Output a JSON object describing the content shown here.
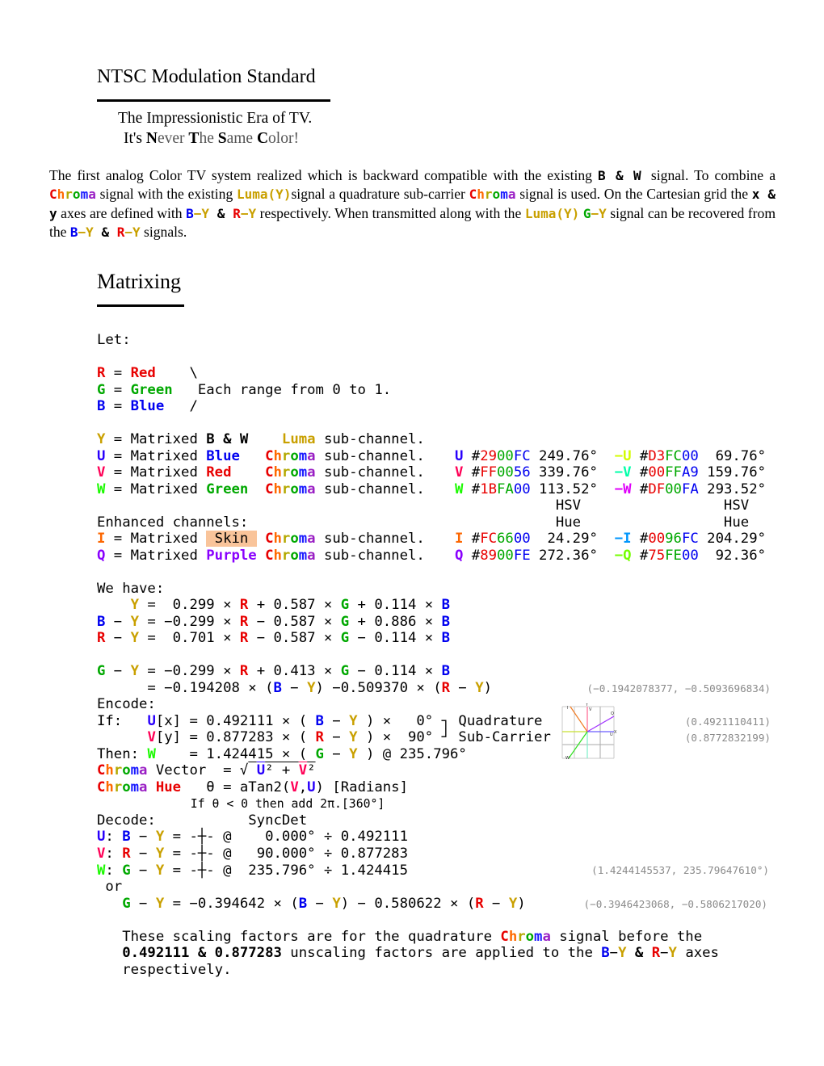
{
  "header": {
    "title": "NTSC Modulation Standard",
    "subtitle_line1": "The Impressionistic Era of TV.",
    "subtitle_line2": [
      [
        "It's ",
        ""
      ],
      [
        "N",
        "b"
      ],
      [
        "ever ",
        "g"
      ],
      [
        "T",
        "b"
      ],
      [
        "he ",
        "g"
      ],
      [
        "S",
        "b"
      ],
      [
        "ame ",
        "g"
      ],
      [
        "C",
        "b"
      ],
      [
        "olor!",
        "g"
      ]
    ]
  },
  "colors": {
    "Y": "#c9a000",
    "R": "#e80000",
    "G": "#00a800",
    "B": "#0000f0",
    "U": "#2900FC",
    "V": "#FF0056",
    "W": "#1BFA00",
    "I": "#FC6600",
    "Q": "#8900FE",
    "nU": "#D3FC00",
    "nV": "#00FFA9",
    "nW": "#DF00FA",
    "nI": "#0096FC",
    "nQ": "#75FE00",
    "K": "#000000",
    "chroma": [
      "#e80000",
      "#ff6a00",
      "#b3a800",
      "#00a800",
      "#1a1aff",
      "#9a1fc4"
    ]
  },
  "intro": [
    [
      "The first analog Color TV system realized which is backward compatible with the existing ",
      "",
      ""
    ],
    [
      " B & W ",
      "",
      "m"
    ],
    [
      " signal. To combine a ",
      "",
      ""
    ],
    [
      "Chroma",
      "CH",
      "m"
    ],
    [
      " signal with the existing ",
      "",
      ""
    ],
    [
      "Luma(Y)",
      "Y",
      "m"
    ],
    [
      "signal a quadrature sub-carrier ",
      "",
      ""
    ],
    [
      "Chroma",
      "CH",
      "m"
    ],
    [
      " signal is used. On the Cartesian grid the ",
      "",
      ""
    ],
    [
      "x & y",
      "",
      "m"
    ],
    [
      " axes are defined with ",
      "",
      ""
    ],
    [
      "B",
      "B",
      "m"
    ],
    [
      "−Y",
      "Y",
      "m"
    ],
    [
      " & ",
      "",
      "m"
    ],
    [
      "R",
      "R",
      "m"
    ],
    [
      "−Y",
      "Y",
      "m"
    ],
    [
      " respectively. When transmitted along with the ",
      "",
      ""
    ],
    [
      "Luma(Y)",
      "Y",
      "m"
    ],
    [
      " ",
      "",
      ""
    ],
    [
      "G",
      "G",
      "m"
    ],
    [
      "−Y",
      "Y",
      "m"
    ],
    [
      " signal can be recovered from the ",
      "",
      ""
    ],
    [
      "B",
      "B",
      "m"
    ],
    [
      "−Y",
      "Y",
      "m"
    ],
    [
      " & ",
      "",
      "m"
    ],
    [
      "R",
      "R",
      "m"
    ],
    [
      "−Y",
      "Y",
      "m"
    ],
    [
      " signals.",
      "",
      ""
    ]
  ],
  "section_title": "Matrixing",
  "lines": [
    [
      [
        "Let:",
        "",
        ""
      ]
    ],
    [],
    [
      [
        "R",
        "R",
        "b"
      ],
      [
        " = ",
        "",
        ""
      ],
      [
        "Red",
        "R",
        "b"
      ],
      [
        "    \\",
        "",
        ""
      ]
    ],
    [
      [
        "G",
        "G",
        "b"
      ],
      [
        " = ",
        "",
        ""
      ],
      [
        "Green",
        "G",
        "b"
      ],
      [
        "   Each range from 0 to 1.",
        "",
        ""
      ]
    ],
    [
      [
        "B",
        "B",
        "b"
      ],
      [
        " = ",
        "",
        ""
      ],
      [
        "Blue",
        "B",
        "b"
      ],
      [
        "   /",
        "",
        ""
      ]
    ],
    [],
    [
      [
        "Y",
        "Y",
        "b"
      ],
      [
        " = Matrixed ",
        "",
        ""
      ],
      [
        "B & W",
        "K",
        "b"
      ],
      [
        "    ",
        "",
        ""
      ],
      [
        "Luma",
        "Y",
        "b"
      ],
      [
        " sub-channel.",
        "",
        ""
      ]
    ],
    [
      [
        "U",
        "U",
        "b"
      ],
      [
        " = Matrixed ",
        "",
        ""
      ],
      [
        "Blue",
        "B",
        "b"
      ],
      [
        "   ",
        "",
        ""
      ],
      [
        "Chroma",
        "CH",
        "b"
      ],
      [
        " sub-channel.",
        "",
        ""
      ]
    ],
    [
      [
        "V",
        "V",
        "b"
      ],
      [
        " = Matrixed ",
        "",
        ""
      ],
      [
        "Red",
        "R",
        "b"
      ],
      [
        "    ",
        "",
        ""
      ],
      [
        "Chroma",
        "CH",
        "b"
      ],
      [
        " sub-channel.",
        "",
        ""
      ]
    ],
    [
      [
        "W",
        "W",
        "b"
      ],
      [
        " = Matrixed ",
        "",
        ""
      ],
      [
        "Green",
        "G",
        "b"
      ],
      [
        "  ",
        "",
        ""
      ],
      [
        "Chroma",
        "CH",
        "b"
      ],
      [
        " sub-channel.",
        "",
        ""
      ]
    ],
    [],
    [
      [
        "Enhanced channels:",
        "",
        ""
      ]
    ],
    [
      [
        "I",
        "I",
        "b"
      ],
      [
        " = Matrixed ",
        "",
        ""
      ],
      [
        " Skin ",
        "",
        "s"
      ],
      [
        " ",
        "",
        ""
      ],
      [
        "Chroma",
        "CH",
        "b"
      ],
      [
        " sub-channel.",
        "",
        ""
      ]
    ],
    [
      [
        "Q",
        "Q",
        "b"
      ],
      [
        " = Matrixed ",
        "",
        ""
      ],
      [
        "Purple",
        "Q",
        "b"
      ],
      [
        " ",
        "",
        ""
      ],
      [
        "Chroma",
        "CH",
        "b"
      ],
      [
        " sub-channel.",
        "",
        ""
      ]
    ],
    [],
    [
      [
        "We have:",
        "",
        ""
      ]
    ],
    [
      [
        "    ",
        "",
        ""
      ],
      [
        "Y",
        "Y",
        "b"
      ],
      [
        " =  0.299 × ",
        "",
        ""
      ],
      [
        "R",
        "R",
        "b"
      ],
      [
        " + 0.587 × ",
        "",
        ""
      ],
      [
        "G",
        "G",
        "b"
      ],
      [
        " + 0.114 × ",
        "",
        ""
      ],
      [
        "B",
        "B",
        "b"
      ]
    ],
    [
      [
        "B",
        "B",
        "b"
      ],
      [
        " − ",
        "",
        ""
      ],
      [
        "Y",
        "Y",
        "b"
      ],
      [
        " = −0.299 × ",
        "",
        ""
      ],
      [
        "R",
        "R",
        "b"
      ],
      [
        " − 0.587 × ",
        "",
        ""
      ],
      [
        "G",
        "G",
        "b"
      ],
      [
        " + 0.886 × ",
        "",
        ""
      ],
      [
        "B",
        "B",
        "b"
      ]
    ],
    [
      [
        "R",
        "R",
        "b"
      ],
      [
        " − ",
        "",
        ""
      ],
      [
        "Y",
        "Y",
        "b"
      ],
      [
        " =  0.701 × ",
        "",
        ""
      ],
      [
        "R",
        "R",
        "b"
      ],
      [
        " − 0.587 × ",
        "",
        ""
      ],
      [
        "G",
        "G",
        "b"
      ],
      [
        " − 0.114 × ",
        "",
        ""
      ],
      [
        "B",
        "B",
        "b"
      ]
    ],
    [],
    [
      [
        "G",
        "G",
        "b"
      ],
      [
        " − ",
        "",
        ""
      ],
      [
        "Y",
        "Y",
        "b"
      ],
      [
        " = −0.299 × ",
        "",
        ""
      ],
      [
        "R",
        "R",
        "b"
      ],
      [
        " + 0.413 × ",
        "",
        ""
      ],
      [
        "G",
        "G",
        "b"
      ],
      [
        " − 0.114 × ",
        "",
        ""
      ],
      [
        "B",
        "B",
        "b"
      ]
    ],
    [
      [
        "      = −0.194208 × (",
        "",
        ""
      ],
      [
        "B",
        "B",
        "b"
      ],
      [
        " − ",
        "",
        ""
      ],
      [
        "Y",
        "Y",
        "b"
      ],
      [
        ") −0.509370 × (",
        "",
        ""
      ],
      [
        "R",
        "R",
        "b"
      ],
      [
        " − ",
        "",
        ""
      ],
      [
        "Y",
        "Y",
        "b"
      ],
      [
        ")",
        "",
        ""
      ]
    ],
    [
      [
        "Encode:",
        "",
        ""
      ]
    ],
    [
      [
        "If:   ",
        "",
        ""
      ],
      [
        "U",
        "U",
        "b"
      ],
      [
        "[x] = 0.492111 × ( ",
        "",
        ""
      ],
      [
        "B",
        "B",
        "b"
      ],
      [
        " − ",
        "",
        ""
      ],
      [
        "Y",
        "Y",
        "b"
      ],
      [
        " ) ×   0° ┐ Quadrature",
        "",
        ""
      ]
    ],
    [
      [
        "      ",
        "",
        ""
      ],
      [
        "V",
        "V",
        "b"
      ],
      [
        "[y] = 0.877283 × ( ",
        "",
        ""
      ],
      [
        "R",
        "R",
        "b"
      ],
      [
        " − ",
        "",
        ""
      ],
      [
        "Y",
        "Y",
        "b"
      ],
      [
        " ) ×  90° ┘ Sub-Carrier",
        "",
        ""
      ]
    ],
    [
      [
        "Then: ",
        "",
        ""
      ],
      [
        "W",
        "W",
        "b"
      ],
      [
        "    = 1.424415 × ( ",
        "",
        ""
      ],
      [
        "G",
        "G",
        "b"
      ],
      [
        " − ",
        "",
        ""
      ],
      [
        "Y",
        "Y",
        "b"
      ],
      [
        " ) @ 235.796°",
        "",
        ""
      ]
    ],
    [
      [
        "Chroma",
        "CH",
        "b"
      ],
      [
        " Vector  = √",
        "",
        ""
      ],
      [
        " ",
        "",
        "o"
      ],
      [
        "U",
        "U",
        "bo"
      ],
      [
        "² + ",
        "",
        "o"
      ],
      [
        "V",
        "V",
        "bo"
      ],
      [
        "²",
        "",
        "o"
      ]
    ],
    [
      [
        "Chroma",
        "CH",
        "b"
      ],
      [
        " ",
        "",
        ""
      ],
      [
        "Hue",
        "R",
        "b"
      ],
      [
        "   θ = aTan2(",
        "",
        ""
      ],
      [
        "V",
        "V",
        "b"
      ],
      [
        ",",
        "",
        ""
      ],
      [
        "U",
        "U",
        "b"
      ],
      [
        ") [Radians]",
        "",
        ""
      ]
    ],
    [
      [
        "             If θ < 0 then add 2π.[360°]",
        "",
        "small"
      ]
    ],
    [
      [
        "Decode:           SyncDet",
        "",
        ""
      ]
    ],
    [
      [
        "U",
        "U",
        "b"
      ],
      [
        ": ",
        "",
        ""
      ],
      [
        "B",
        "B",
        "b"
      ],
      [
        " − ",
        "",
        ""
      ],
      [
        "Y",
        "Y",
        "b"
      ],
      [
        " = -┼- @    0.000° ÷ 0.492111",
        "",
        ""
      ]
    ],
    [
      [
        "V",
        "V",
        "b"
      ],
      [
        ": ",
        "",
        ""
      ],
      [
        "R",
        "R",
        "b"
      ],
      [
        " − ",
        "",
        ""
      ],
      [
        "Y",
        "Y",
        "b"
      ],
      [
        " = -┼- @   90.000° ÷ 0.877283",
        "",
        ""
      ]
    ],
    [
      [
        "W",
        "W",
        "b"
      ],
      [
        ": ",
        "",
        ""
      ],
      [
        "G",
        "G",
        "b"
      ],
      [
        " − ",
        "",
        ""
      ],
      [
        "Y",
        "Y",
        "b"
      ],
      [
        " = -┼- @  235.796° ÷ 1.424415",
        "",
        ""
      ]
    ],
    [
      [
        " or",
        "",
        ""
      ]
    ],
    [
      [
        "   ",
        "",
        ""
      ],
      [
        "G",
        "G",
        "b"
      ],
      [
        " − ",
        "",
        ""
      ],
      [
        "Y",
        "Y",
        "b"
      ],
      [
        " = −0.394642 × (",
        "",
        ""
      ],
      [
        "B",
        "B",
        "b"
      ],
      [
        " − ",
        "",
        ""
      ],
      [
        "Y",
        "Y",
        "b"
      ],
      [
        ") − 0.580622 × (",
        "",
        ""
      ],
      [
        "R",
        "R",
        "b"
      ],
      [
        " − ",
        "",
        ""
      ],
      [
        "Y",
        "Y",
        "b"
      ],
      [
        ")",
        "",
        ""
      ]
    ],
    [],
    [
      [
        "   These scaling factors are for the quadrature ",
        "",
        ""
      ],
      [
        "Chroma",
        "CH",
        "b"
      ],
      [
        " signal before the",
        "",
        ""
      ]
    ],
    [
      [
        "   ",
        "",
        ""
      ],
      [
        "0.492111 & 0.877283",
        "",
        "b"
      ],
      [
        " unscaling factors are applied to the ",
        "",
        ""
      ],
      [
        "B",
        "B",
        "b"
      ],
      [
        "−",
        "",
        ""
      ],
      [
        "Y",
        "Y",
        "b"
      ],
      [
        " & ",
        "",
        "b"
      ],
      [
        "R",
        "R",
        "b"
      ],
      [
        "−",
        "",
        ""
      ],
      [
        "Y",
        "Y",
        "b"
      ],
      [
        " axes",
        "",
        ""
      ]
    ],
    [
      [
        "   respectively.",
        "",
        ""
      ]
    ]
  ],
  "table": [
    [],
    [],
    [],
    [],
    [],
    [],
    [],
    [
      [
        "U",
        "U",
        "b"
      ],
      [
        " #",
        "",
        ""
      ],
      [
        "29",
        "R",
        ""
      ],
      [
        "00",
        "G",
        ""
      ],
      [
        "FC",
        "B",
        ""
      ],
      [
        " 249.76°  ",
        "",
        ""
      ],
      [
        "−U",
        "nU",
        "b"
      ],
      [
        " #",
        "",
        ""
      ],
      [
        "D3",
        "R",
        ""
      ],
      [
        "FC",
        "G",
        ""
      ],
      [
        "00",
        "B",
        ""
      ],
      [
        "  69.76°",
        "",
        ""
      ]
    ],
    [
      [
        "V",
        "V",
        "b"
      ],
      [
        " #",
        "",
        ""
      ],
      [
        "FF",
        "R",
        ""
      ],
      [
        "00",
        "G",
        ""
      ],
      [
        "56",
        "B",
        ""
      ],
      [
        " 339.76°  ",
        "",
        ""
      ],
      [
        "−V",
        "nV",
        "b"
      ],
      [
        " #",
        "",
        ""
      ],
      [
        "00",
        "R",
        ""
      ],
      [
        "FF",
        "G",
        ""
      ],
      [
        "A9",
        "B",
        ""
      ],
      [
        " 159.76°",
        "",
        ""
      ]
    ],
    [
      [
        "W",
        "W",
        "b"
      ],
      [
        " #",
        "",
        ""
      ],
      [
        "1B",
        "R",
        ""
      ],
      [
        "FA",
        "G",
        ""
      ],
      [
        "00",
        "B",
        ""
      ],
      [
        " 113.52°  ",
        "",
        ""
      ],
      [
        "−W",
        "nW",
        "b"
      ],
      [
        " #",
        "",
        ""
      ],
      [
        "DF",
        "R",
        ""
      ],
      [
        "00",
        "G",
        ""
      ],
      [
        "FA",
        "B",
        ""
      ],
      [
        " 293.52°",
        "",
        ""
      ]
    ],
    [
      [
        "            HSV                 HSV",
        "",
        ""
      ]
    ],
    [
      [
        "            Hue                 Hue",
        "",
        ""
      ]
    ],
    [
      [
        "I",
        "I",
        "b"
      ],
      [
        " #",
        "",
        ""
      ],
      [
        "FC",
        "R",
        ""
      ],
      [
        "66",
        "G",
        ""
      ],
      [
        "00",
        "B",
        ""
      ],
      [
        "  24.29°  ",
        "",
        ""
      ],
      [
        "−I",
        "nI",
        "b"
      ],
      [
        " #",
        "",
        ""
      ],
      [
        "00",
        "R",
        ""
      ],
      [
        "96",
        "G",
        ""
      ],
      [
        "FC",
        "B",
        ""
      ],
      [
        " 204.29°",
        "",
        ""
      ]
    ],
    [
      [
        "Q",
        "Q",
        "b"
      ],
      [
        " #",
        "",
        ""
      ],
      [
        "89",
        "R",
        ""
      ],
      [
        "00",
        "G",
        ""
      ],
      [
        "FE",
        "B",
        ""
      ],
      [
        " 272.36°  ",
        "",
        ""
      ],
      [
        "−Q",
        "nQ",
        "b"
      ],
      [
        " #",
        "",
        ""
      ],
      [
        "75",
        "R",
        ""
      ],
      [
        "FE",
        "G",
        ""
      ],
      [
        "00",
        "B",
        ""
      ],
      [
        "  92.36°",
        "",
        ""
      ]
    ]
  ],
  "notes": {
    "gy_coeffs": "(−0.1942078377, −0.5093696834)",
    "u_scale": "(0.4921110411)",
    "v_scale": "(0.8772832199)",
    "w_scale": "(1.4244145537, 235.79647610°)",
    "gy_uv": "(−0.3946423068, −0.5806217020)"
  },
  "diagram": {
    "labels": {
      "I": "I",
      "Y": "Y",
      "V": "V",
      "Q": "Q",
      "X": "X",
      "U": "U",
      "W": "W"
    }
  }
}
